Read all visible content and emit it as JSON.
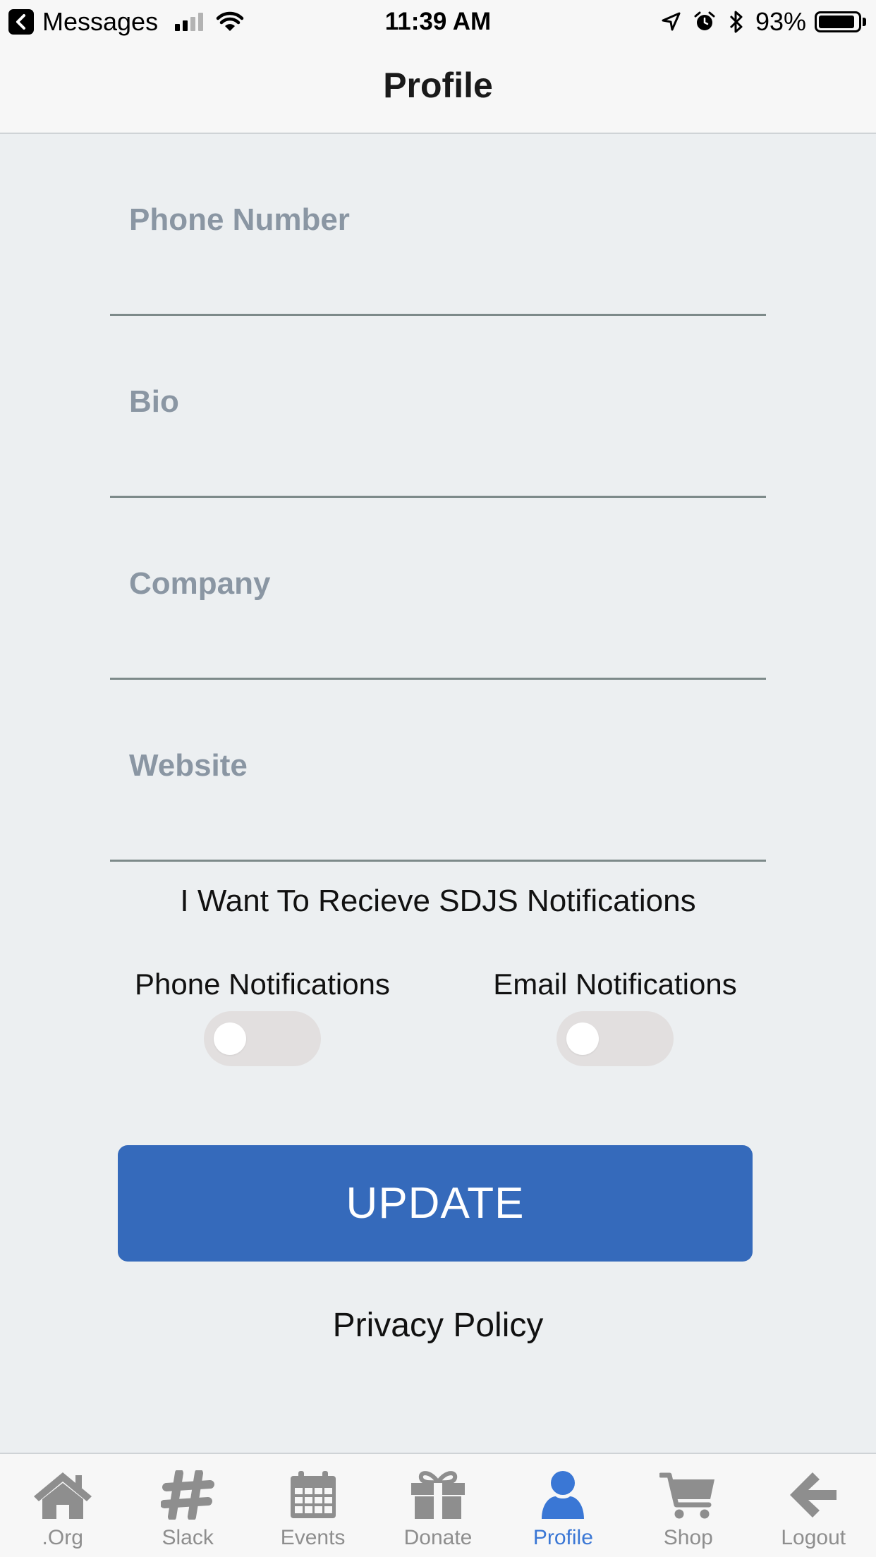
{
  "status_bar": {
    "back_app": "Messages",
    "time": "11:39 AM",
    "battery_percent": "93%",
    "battery_level": 0.93,
    "signal_bars_active": 2,
    "signal_bars_total": 4
  },
  "nav": {
    "title": "Profile"
  },
  "form": {
    "fields": [
      {
        "placeholder": "Phone Number",
        "value": ""
      },
      {
        "placeholder": "Bio",
        "value": ""
      },
      {
        "placeholder": "Company",
        "value": ""
      },
      {
        "placeholder": "Website",
        "value": ""
      }
    ]
  },
  "notifications": {
    "heading": "I Want To Recieve SDJS Notifications",
    "phone": {
      "label": "Phone Notifications",
      "on": false
    },
    "email": {
      "label": "Email Notifications",
      "on": false
    }
  },
  "actions": {
    "update_label": "UPDATE",
    "privacy_label": "Privacy Policy"
  },
  "tabs": [
    {
      "label": ".Org",
      "icon": "home-icon",
      "active": false
    },
    {
      "label": "Slack",
      "icon": "hashtag-icon",
      "active": false
    },
    {
      "label": "Events",
      "icon": "calendar-icon",
      "active": false
    },
    {
      "label": "Donate",
      "icon": "gift-icon",
      "active": false
    },
    {
      "label": "Profile",
      "icon": "user-icon",
      "active": true
    },
    {
      "label": "Shop",
      "icon": "cart-icon",
      "active": false
    },
    {
      "label": "Logout",
      "icon": "arrow-left-icon",
      "active": false
    }
  ],
  "colors": {
    "accent": "#356abb",
    "tab_active": "#3a77d5",
    "tab_inactive": "#8e8e8e",
    "placeholder": "#8a96a3",
    "background": "#eceff1",
    "toggle_off": "#e2dfdf"
  }
}
